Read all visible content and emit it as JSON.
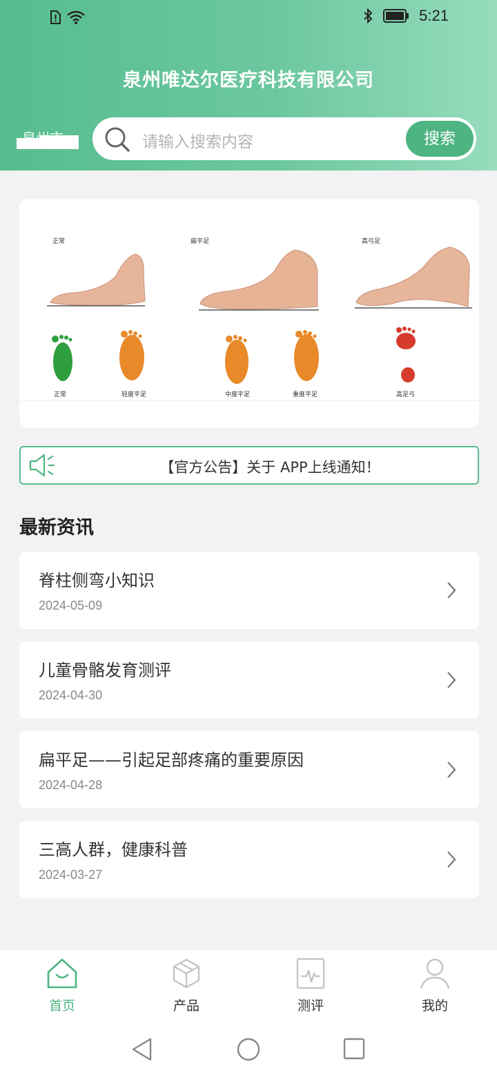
{
  "status_bar": {
    "time": "5:21"
  },
  "header": {
    "title": "泉州唯达尔医疗科技有限公司",
    "location": "泉州市",
    "search_placeholder": "请输入搜索内容",
    "search_button": "搜索"
  },
  "banner": {
    "top_labels": [
      "正常",
      "扁平足",
      "高弓足"
    ],
    "bottom_labels": [
      "正常",
      "轻度平足",
      "中度平足",
      "重度平足",
      "高足弓"
    ]
  },
  "notice": {
    "text": "【官方公告】关于 APP上线通知！"
  },
  "news_section": {
    "title": "最新资讯",
    "items": [
      {
        "title": "脊柱侧弯小知识",
        "date": "2024-05-09"
      },
      {
        "title": "儿童骨骼发育测评",
        "date": "2024-04-30"
      },
      {
        "title": "扁平足——引起足部疼痛的重要原因",
        "date": "2024-04-28"
      },
      {
        "title": "三高人群，健康科普",
        "date": "2024-03-27"
      }
    ]
  },
  "tab_bar": {
    "items": [
      {
        "label": "首页",
        "icon": "home-icon",
        "active": true
      },
      {
        "label": "产品",
        "icon": "box-icon",
        "active": false
      },
      {
        "label": "测评",
        "icon": "report-icon",
        "active": false
      },
      {
        "label": "我的",
        "icon": "person-icon",
        "active": false
      }
    ]
  },
  "colors": {
    "accent": "#4db482",
    "header_start": "#56bd8e",
    "header_end": "#96dcbd"
  }
}
